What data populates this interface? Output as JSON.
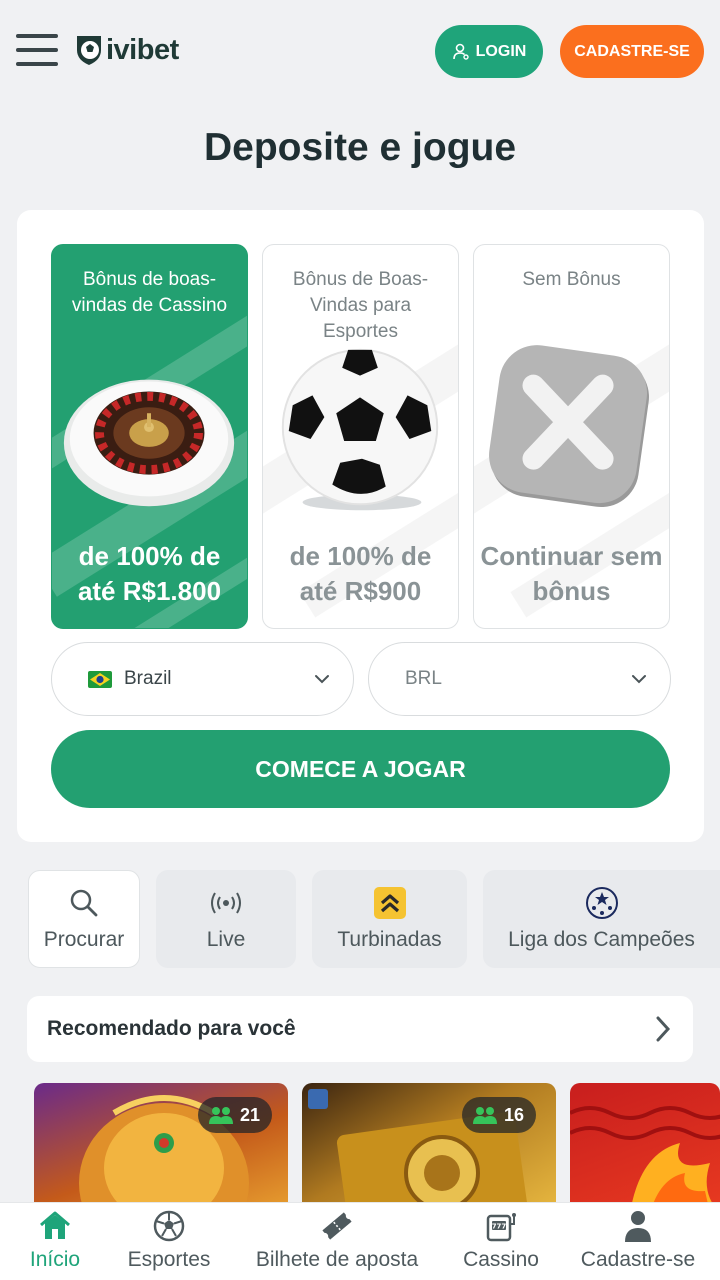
{
  "header": {
    "logo_text": "ivibet",
    "login_label": "LOGIN",
    "register_label": "CADASTRE-SE",
    "colors": {
      "login": "#1fa47a",
      "register": "#fb6f1e"
    }
  },
  "page": {
    "title": "Deposite e jogue"
  },
  "bonuses": [
    {
      "title": "Bônus de boas-vindas de Cassino",
      "amount": "de 100% de até R$1.800",
      "selected": true,
      "icon": "roulette-icon"
    },
    {
      "title": "Bônus de Boas-Vindas para Esportes",
      "amount": "de 100% de até R$900",
      "selected": false,
      "icon": "soccer-ball-icon"
    },
    {
      "title": "Sem Bônus",
      "amount": "Continuar sem bônus",
      "selected": false,
      "icon": "close-x-icon"
    }
  ],
  "country_select": {
    "value": "Brazil",
    "icon": "brazil-flag-icon"
  },
  "currency_select": {
    "value": "BRL"
  },
  "cta_label": "COMECE A JOGAR",
  "quick_nav": [
    {
      "label": "Procurar",
      "icon": "search-icon"
    },
    {
      "label": "Live",
      "icon": "broadcast-icon"
    },
    {
      "label": "Turbinadas",
      "icon": "boost-chevrons-icon"
    },
    {
      "label": "Liga dos Campeões",
      "icon": "champions-league-icon"
    }
  ],
  "recommended": {
    "label": "Recomendado para você"
  },
  "games": [
    {
      "players": "21"
    },
    {
      "players": "16"
    },
    {
      "players": ""
    }
  ],
  "bottom_nav": [
    {
      "label": "Início",
      "icon": "home-icon",
      "active": true
    },
    {
      "label": "Esportes",
      "icon": "soccer-ball-icon",
      "active": false
    },
    {
      "label": "Bilhete de aposta",
      "icon": "ticket-icon",
      "active": false
    },
    {
      "label": "Cassino",
      "icon": "slot-machine-icon",
      "active": false
    },
    {
      "label": "Cadastre-se",
      "icon": "user-icon",
      "active": false
    }
  ],
  "brand_green": "#23a071"
}
